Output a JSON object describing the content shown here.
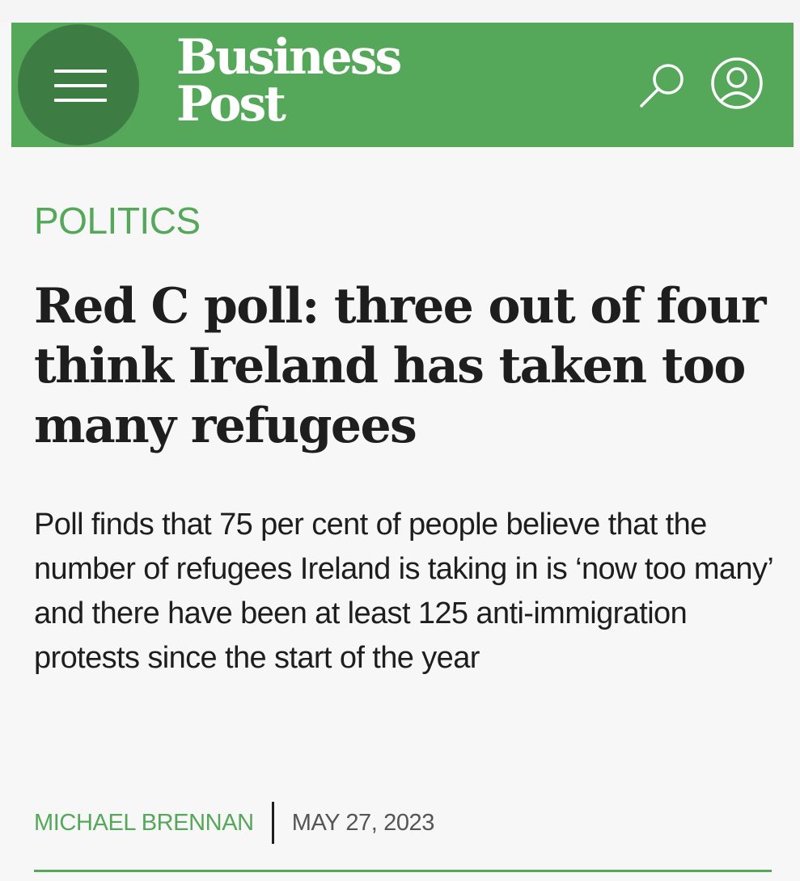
{
  "header": {
    "logo_line1": "Business",
    "logo_line2": "Post",
    "background_color": "#55a75a",
    "menu_button_color": "#3d7d44",
    "icons": {
      "menu": "hamburger-menu-icon",
      "search": "search-icon",
      "account": "account-icon"
    }
  },
  "article": {
    "section": "POLITICS",
    "headline": "Red C poll: three out of four think Ireland has taken too many refugees",
    "summary": "Poll finds that 75 per cent of people believe that the number of refugees Ireland is taking in is ‘now too many’ and there have been at least 125 anti-immigration protests since the start of the year",
    "author": "MICHAEL BRENNAN",
    "date": "MAY 27, 2023"
  },
  "colors": {
    "accent": "#55a75a",
    "text": "#1e1e1e",
    "date_text": "#555555",
    "page_background": "#f7f7f7"
  }
}
